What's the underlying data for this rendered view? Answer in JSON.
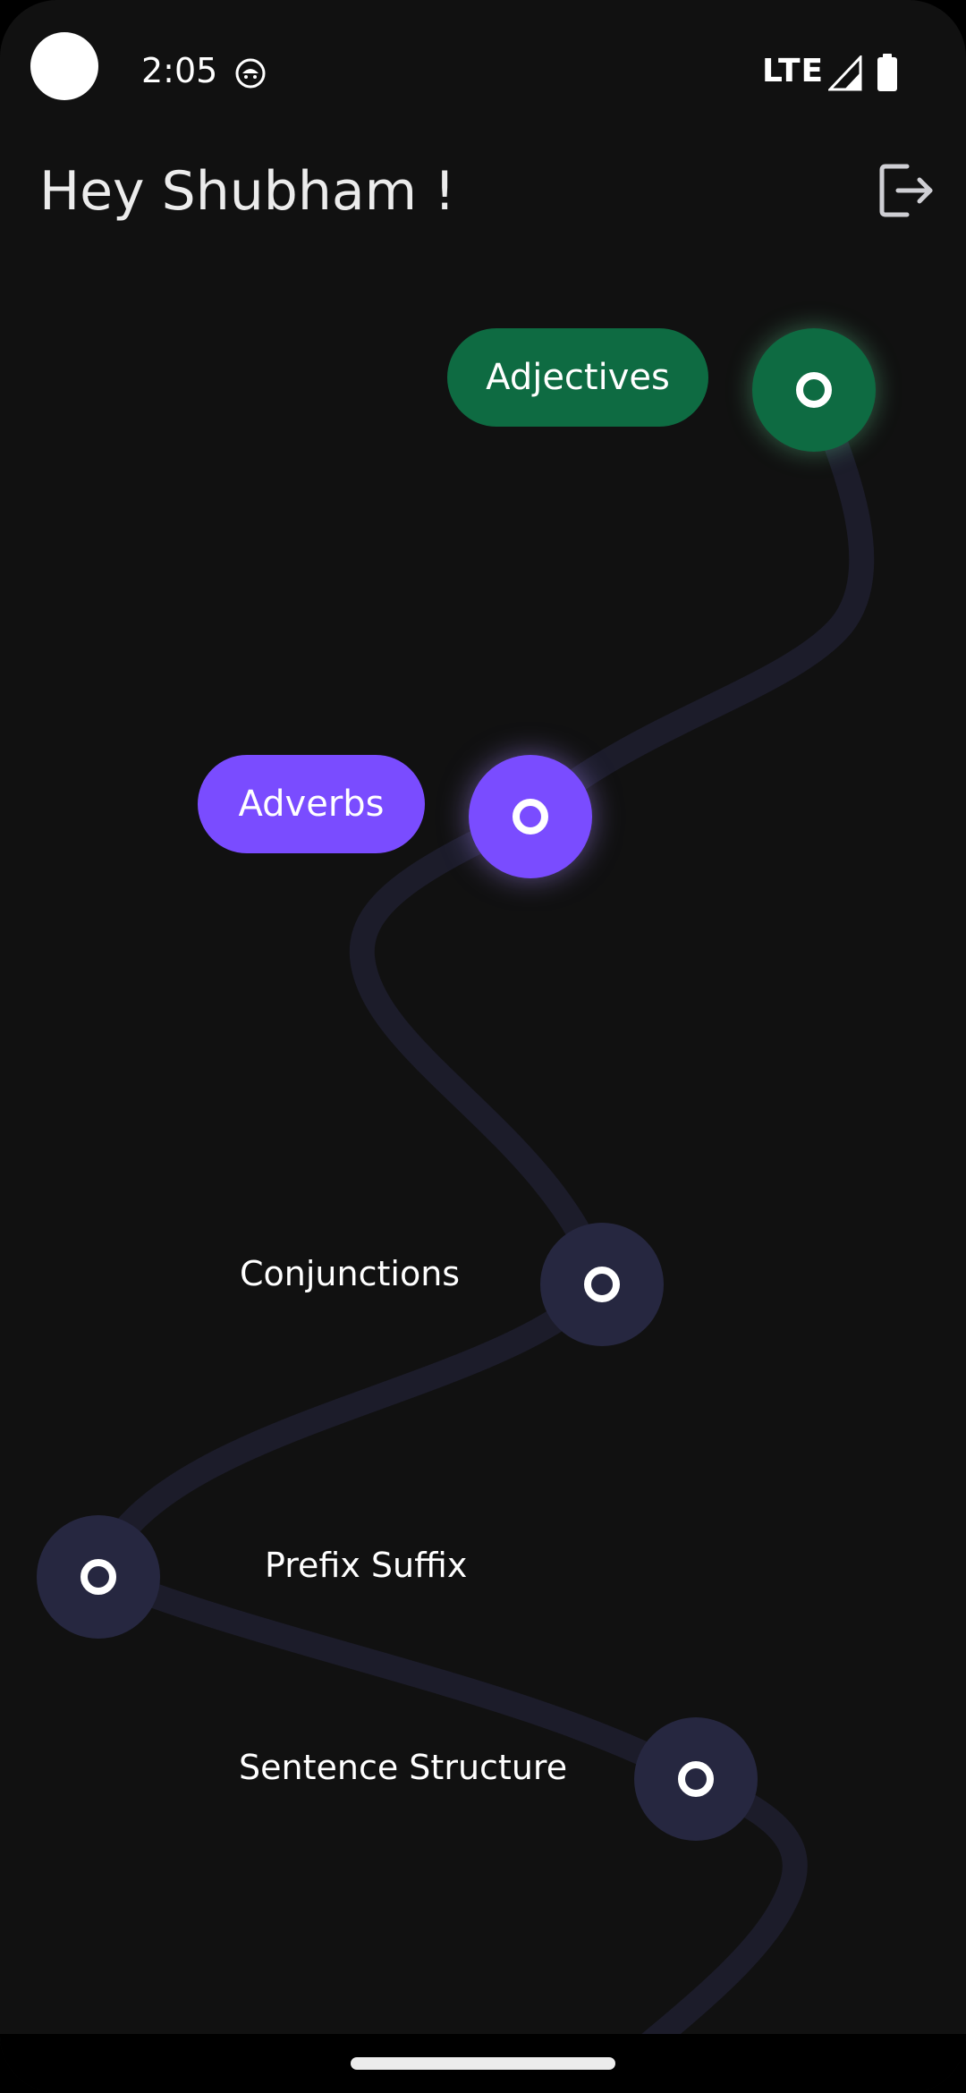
{
  "status_bar": {
    "time": "2:05",
    "network": "LTE",
    "icons": [
      "app-notification-icon",
      "signal-icon",
      "battery-icon"
    ]
  },
  "header": {
    "greeting": "Hey Shubham !",
    "logout_icon": "logout-icon"
  },
  "lessons": [
    {
      "label": "Adjectives",
      "state": "completed",
      "color": "#0e6b42"
    },
    {
      "label": "Adverbs",
      "state": "current",
      "color": "#7a4cff"
    },
    {
      "label": "Conjunctions",
      "state": "locked",
      "color": "#262740"
    },
    {
      "label": "Prefix Suffix",
      "state": "locked",
      "color": "#262740"
    },
    {
      "label": "Sentence Structure",
      "state": "locked",
      "color": "#262740"
    }
  ],
  "colors": {
    "background": "#111111",
    "path": "#1c1c2a",
    "completed": "#0e6b42",
    "current": "#7a4cff",
    "locked": "#262740"
  }
}
